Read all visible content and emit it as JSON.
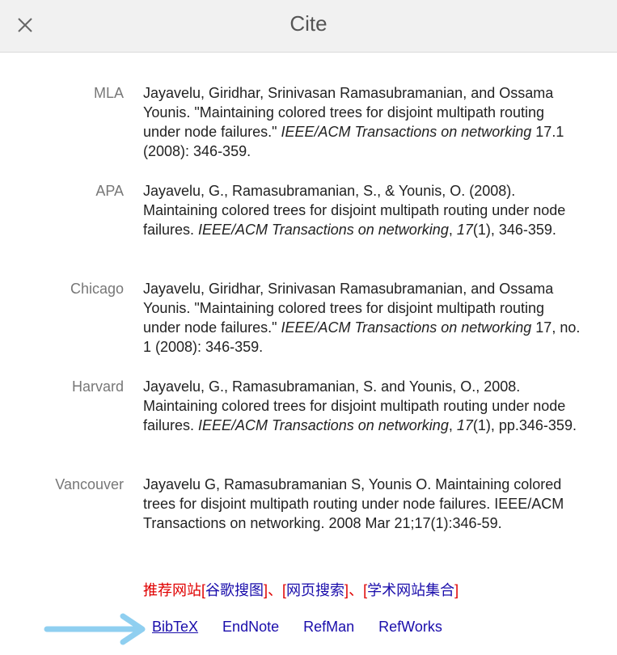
{
  "dialog": {
    "title": "Cite",
    "close_icon": "close-icon"
  },
  "citations": [
    {
      "label": "MLA",
      "parts": [
        {
          "text": "Jayavelu, Giridhar, Srinivasan Ramasubramanian, and Ossama Younis. \"Maintaining colored trees for disjoint multipath routing under node failures.\" ",
          "italic": false
        },
        {
          "text": "IEEE/ACM Transactions on networking",
          "italic": true
        },
        {
          "text": " 17.1 (2008): 346-359.",
          "italic": false
        }
      ]
    },
    {
      "label": "APA",
      "parts": [
        {
          "text": "Jayavelu, G., Ramasubramanian, S., & Younis, O. (2008). Maintaining colored trees for disjoint multipath routing under node failures. ",
          "italic": false
        },
        {
          "text": "IEEE/ACM Transactions on networking",
          "italic": true
        },
        {
          "text": ", ",
          "italic": false
        },
        {
          "text": "17",
          "italic": true
        },
        {
          "text": "(1), 346-359.",
          "italic": false
        }
      ]
    },
    {
      "label": "Chicago",
      "parts": [
        {
          "text": "Jayavelu, Giridhar, Srinivasan Ramasubramanian, and Ossama Younis. \"Maintaining colored trees for disjoint multipath routing under node failures.\" ",
          "italic": false
        },
        {
          "text": "IEEE/ACM Transactions on networking",
          "italic": true
        },
        {
          "text": " 17, no. 1 (2008): 346-359.",
          "italic": false
        }
      ]
    },
    {
      "label": "Harvard",
      "parts": [
        {
          "text": "Jayavelu, G., Ramasubramanian, S. and Younis, O., 2008. Maintaining colored trees for disjoint multipath routing under node failures. ",
          "italic": false
        },
        {
          "text": "IEEE/ACM Transactions on networking",
          "italic": true
        },
        {
          "text": ", ",
          "italic": false
        },
        {
          "text": "17",
          "italic": true
        },
        {
          "text": "(1), pp.346-359.",
          "italic": false
        }
      ]
    },
    {
      "label": "Vancouver",
      "parts": [
        {
          "text": "Jayavelu G, Ramasubramanian S, Younis O. Maintaining colored trees for disjoint multipath routing under node failures. IEEE/ACM Transactions on networking. 2008 Mar 21;17(1):346-59.",
          "italic": false
        }
      ]
    }
  ],
  "recommended": {
    "prefix": "推荐网站",
    "bracket_open": "[",
    "bracket_close": "]",
    "separator": "、",
    "links": [
      "谷歌搜图",
      "网页搜索",
      "学术网站集合"
    ]
  },
  "export": {
    "links": [
      "BibTeX",
      "EndNote",
      "RefMan",
      "RefWorks"
    ]
  },
  "colors": {
    "link": "#1a0dab",
    "recommend_red": "#e00000",
    "arrow": "#8fcff0"
  }
}
